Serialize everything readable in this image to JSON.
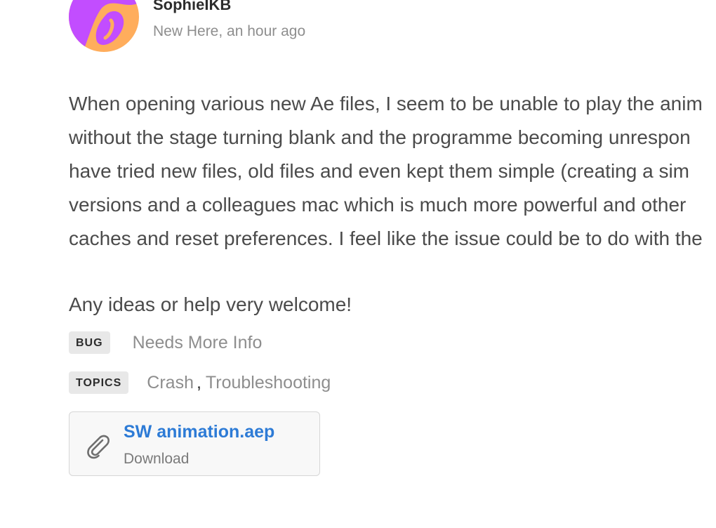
{
  "author": {
    "name": "SophieIKB",
    "status": "New Here, an hour ago",
    "avatar_colors": [
      "#c24dff",
      "#ffad5c"
    ]
  },
  "post": {
    "lines": [
      "When opening various new Ae files, I seem to be unable to play the anim",
      "without the stage turning blank and the programme becoming unrespon",
      "have tried new files, old files and even kept them simple (creating a sim",
      "versions and a colleagues mac which is much more powerful and other",
      "caches and reset preferences. I feel like the issue could be to do with the"
    ],
    "closing": "Any ideas or help very welcome!"
  },
  "labels": {
    "bug": {
      "tag": "BUG",
      "value": "Needs More Info"
    },
    "topics": {
      "tag": "TOPICS",
      "items": [
        "Crash",
        "Troubleshooting"
      ],
      "separator": ","
    }
  },
  "attachment": {
    "icon": "paperclip-icon",
    "file_name": "SW animation.aep",
    "action": "Download"
  },
  "colors": {
    "link": "#2d7bd6",
    "muted": "#8e8e8e",
    "tag_bg": "#e8e8e8"
  }
}
